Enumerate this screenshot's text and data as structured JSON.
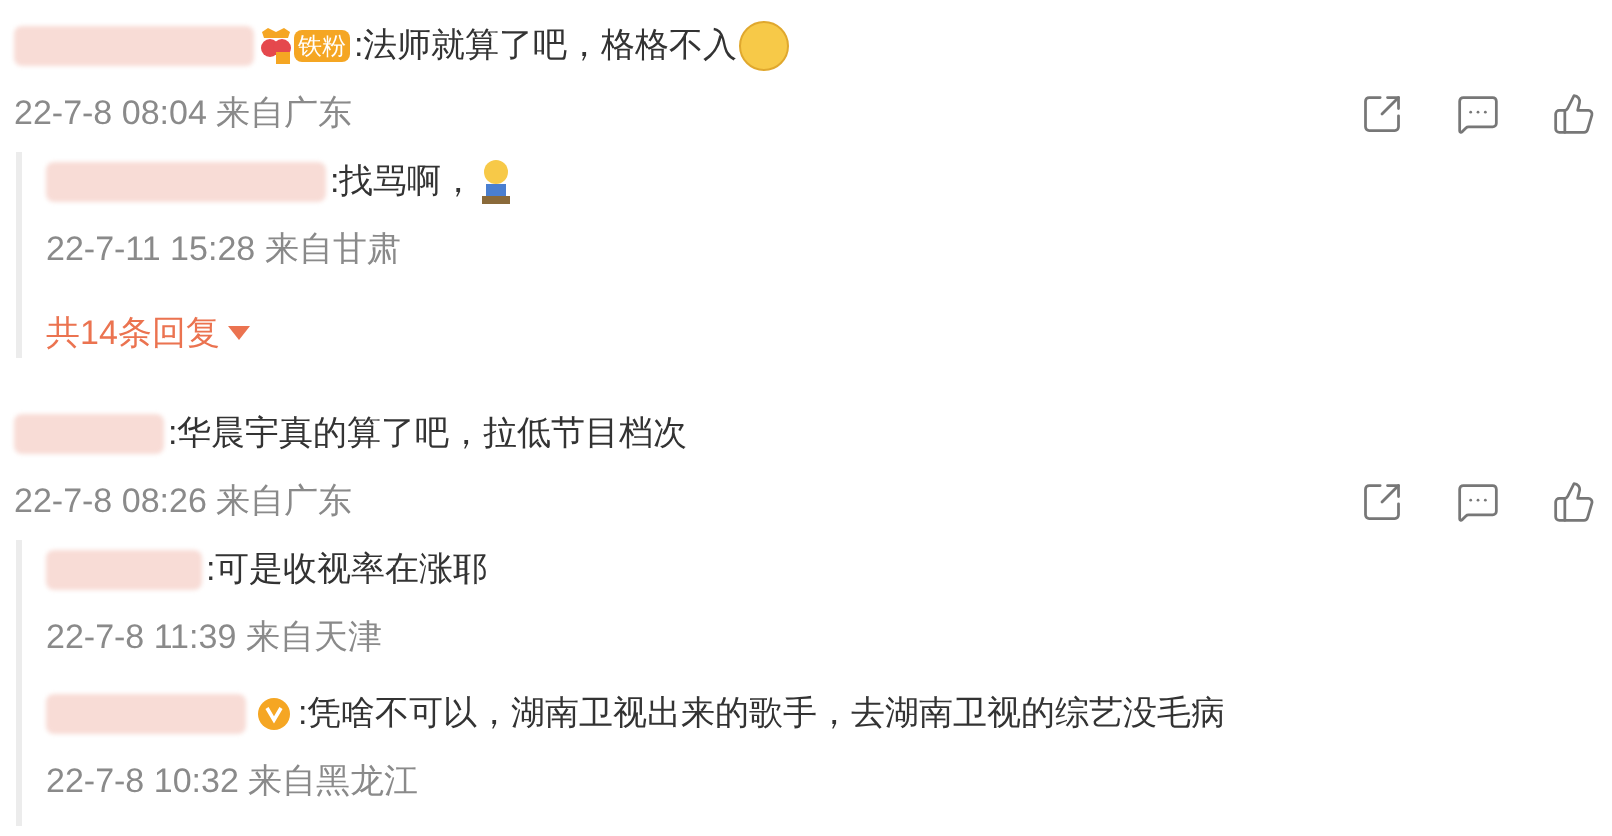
{
  "comments": [
    {
      "badge": {
        "kind": "fan",
        "label": "铁粉"
      },
      "text": ":法师就算了吧，格格不入",
      "emoji": {
        "kind": "face"
      },
      "meta": "22-7-8 08:04 来自广东",
      "replies": [
        {
          "text": ":找骂啊，",
          "emoji": {
            "kind": "figure"
          },
          "meta": "22-7-11 15:28 来自甘肃"
        }
      ],
      "more_replies": "共14条回复"
    },
    {
      "text": ":华晨宇真的算了吧，拉低节目档次",
      "meta": "22-7-8 08:26 来自广东",
      "replies": [
        {
          "text": ":可是收视率在涨耶",
          "meta": "22-7-8 11:39 来自天津"
        },
        {
          "badge": {
            "kind": "verified"
          },
          "text": ":凭啥不可以，湖南卫视出来的歌手，去湖南卫视的综艺没毛病",
          "meta": "22-7-8 10:32 来自黑龙江"
        }
      ]
    }
  ]
}
